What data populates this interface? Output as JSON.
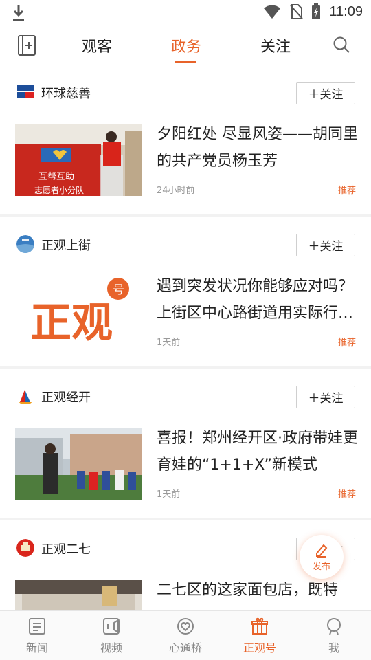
{
  "status": {
    "time": "11:09",
    "icons": [
      "download-icon",
      "wifi-icon",
      "no-sim-icon",
      "battery-charging-icon"
    ]
  },
  "top_nav": {
    "tabs": [
      {
        "label": "观客"
      },
      {
        "label": "政务"
      },
      {
        "label": "关注"
      }
    ],
    "active_tab": "政务",
    "icons": [
      "add-tab-icon",
      "search-icon"
    ]
  },
  "feed": [
    {
      "source": "环球慈善",
      "follow_label": "＋关注",
      "title": "夕阳红处 尽显风姿——胡同里的共产党员杨玉芳",
      "time": "24小时前",
      "tag": "推荐",
      "thumb_text": [
        "互帮互助",
        "志愿者小分队"
      ]
    },
    {
      "source": "正观上街",
      "follow_label": "＋关注",
      "title": "遇到突发状况你能够应对吗？上街区中心路街道用实际行动告诉你",
      "time": "1天前",
      "tag": "推荐",
      "thumb_text": [
        "正观",
        "号"
      ]
    },
    {
      "source": "正观经开",
      "follow_label": "＋关注",
      "title": "喜报！郑州经开区·政府带娃更育娃的“1+1+X”新模式",
      "time": "1天前",
      "tag": "推荐"
    },
    {
      "source": "正观二七",
      "follow_label": "＋关注",
      "title": "二七区的这家面包店，既特",
      "time": "",
      "tag": ""
    }
  ],
  "fab": {
    "label": "发布"
  },
  "bottom_nav": [
    {
      "label": "新闻"
    },
    {
      "label": "视频"
    },
    {
      "label": "心通桥"
    },
    {
      "label": "正观号"
    },
    {
      "label": "我"
    }
  ],
  "colors": {
    "accent": "#e8632a",
    "divider": "#f2f2f2"
  }
}
